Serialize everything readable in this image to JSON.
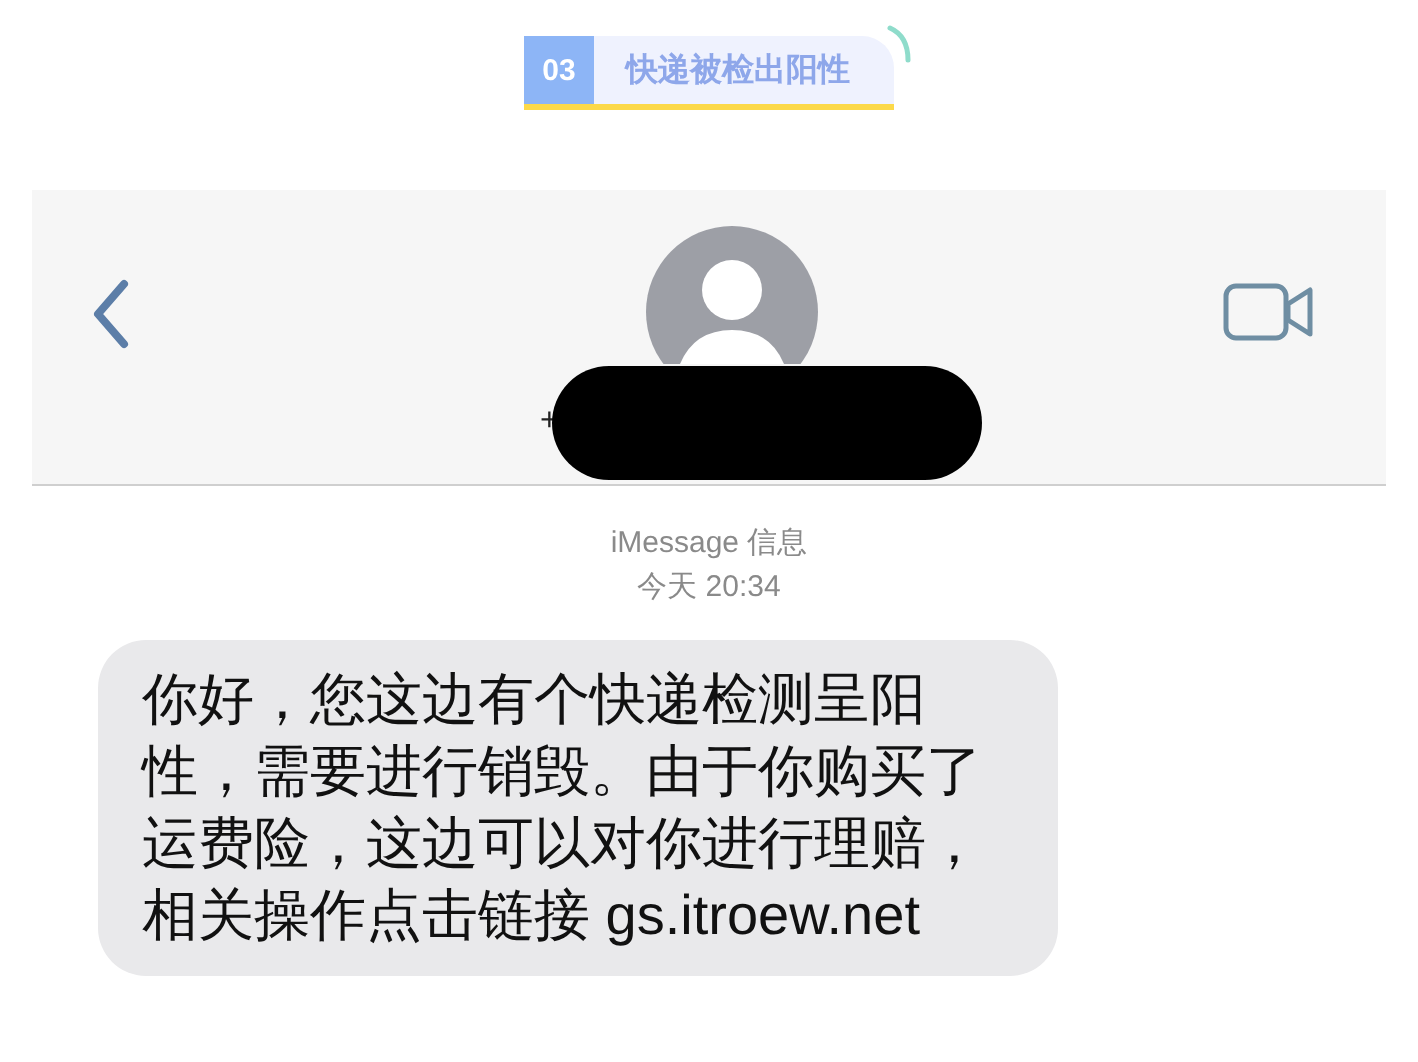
{
  "heading": {
    "number": "03",
    "title": "快递被检出阳性"
  },
  "chat_header": {
    "contact_prefix": "+",
    "name_redacted": true
  },
  "thread": {
    "service": "iMessage 信息",
    "timestamp": "今天 20:34"
  },
  "message": {
    "lines": [
      "你好，您这边有个快递检测呈阳",
      "性，需要进行销毁。由于你购买了",
      "运费险，这边可以对你进行理赔，",
      "相关操作点击链接 gs.itroew.net"
    ]
  }
}
